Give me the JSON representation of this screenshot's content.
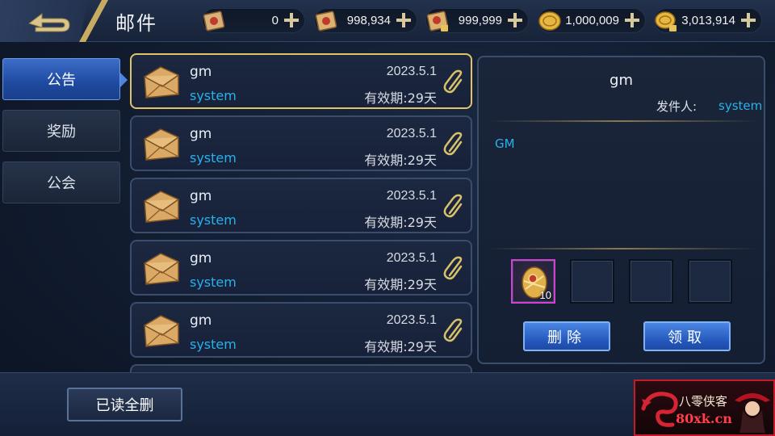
{
  "header": {
    "title": "邮件",
    "currencies": [
      {
        "name": "scroll-red",
        "value": "0"
      },
      {
        "name": "scroll-gold",
        "value": "998,934"
      },
      {
        "name": "scroll-locked",
        "value": "999,999"
      },
      {
        "name": "gold-coin",
        "value": "1,000,009"
      },
      {
        "name": "gold-coin-locked",
        "value": "3,013,914"
      }
    ]
  },
  "tabs": [
    {
      "label": "公告",
      "active": true
    },
    {
      "label": "奖励",
      "active": false
    },
    {
      "label": "公会",
      "active": false
    }
  ],
  "mails": [
    {
      "title": "gm",
      "sender": "system",
      "date": "2023.5.1",
      "expire": "有效期:29天",
      "selected": true
    },
    {
      "title": "gm",
      "sender": "system",
      "date": "2023.5.1",
      "expire": "有效期:29天",
      "selected": false
    },
    {
      "title": "gm",
      "sender": "system",
      "date": "2023.5.1",
      "expire": "有效期:29天",
      "selected": false
    },
    {
      "title": "gm",
      "sender": "system",
      "date": "2023.5.1",
      "expire": "有效期:29天",
      "selected": false
    },
    {
      "title": "gm",
      "sender": "system",
      "date": "2023.5.1",
      "expire": "有效期:29天",
      "selected": false
    }
  ],
  "detail": {
    "title": "gm",
    "from_label": "发件人:",
    "from_value": "system",
    "body": "GM",
    "attachments": [
      {
        "icon": "golden-egg-icon",
        "count": "10"
      },
      {
        "icon": "",
        "count": ""
      },
      {
        "icon": "",
        "count": ""
      },
      {
        "icon": "",
        "count": ""
      }
    ],
    "delete_label": "删除",
    "claim_label": "领取"
  },
  "footer": {
    "delete_read_label": "已读全删"
  },
  "watermark": {
    "top": "八零侠客",
    "bottom": "80xk.cn"
  },
  "colors": {
    "accent_blue": "#2ab0ea",
    "selected_border": "#e2c36a",
    "button_blue": "#2356bb"
  }
}
